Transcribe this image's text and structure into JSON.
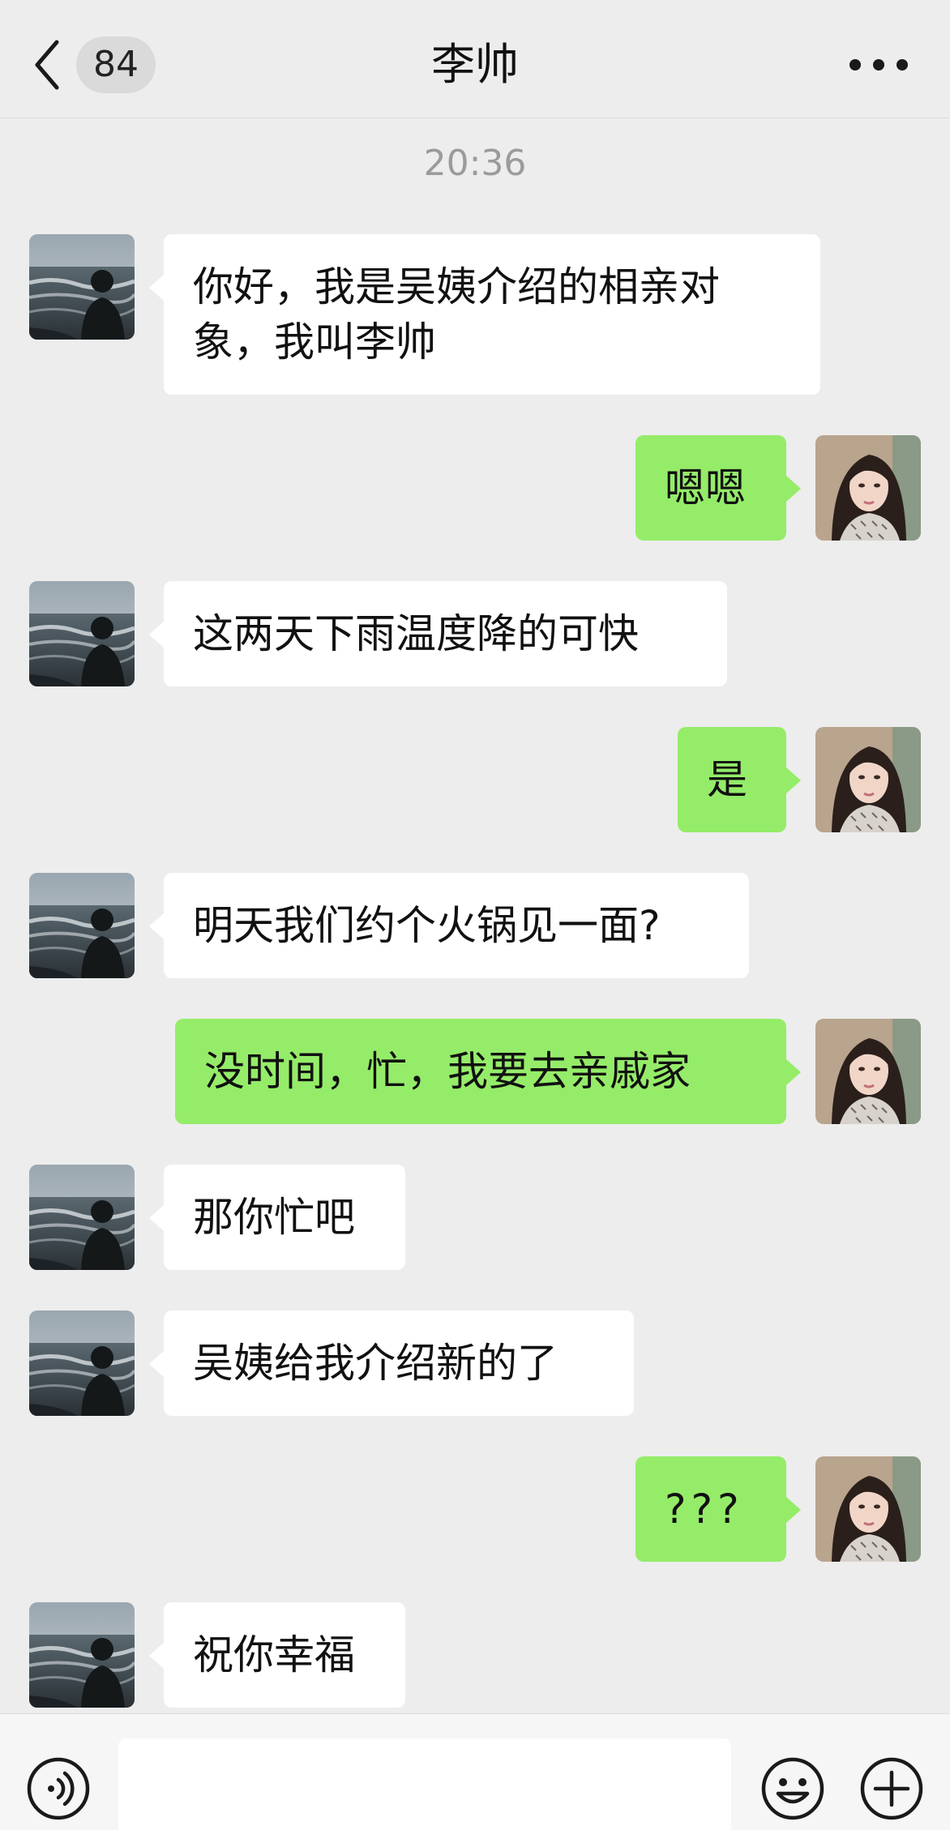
{
  "header": {
    "unread_count": "84",
    "title": "李帅"
  },
  "chat": {
    "timestamp": "20:36",
    "messages": [
      {
        "side": "in",
        "text": "你好，我是吴姨介绍的相亲对象，我叫李帅"
      },
      {
        "side": "out",
        "text": "嗯嗯"
      },
      {
        "side": "in",
        "text": "这两天下雨温度降的可快"
      },
      {
        "side": "out",
        "text": "是"
      },
      {
        "side": "in",
        "text": "明天我们约个火锅见一面?"
      },
      {
        "side": "out",
        "text": "没时间，忙，我要去亲戚家"
      },
      {
        "side": "in",
        "text": "那你忙吧"
      },
      {
        "side": "in",
        "text": "吴姨给我介绍新的了"
      },
      {
        "side": "out",
        "text": "???"
      },
      {
        "side": "in",
        "text": "祝你幸福"
      }
    ]
  },
  "input_bar": {
    "voice_icon": "voice-icon",
    "emoji_icon": "emoji-icon",
    "plus_icon": "plus-icon",
    "input_value": ""
  },
  "colors": {
    "background": "#ededed",
    "incoming_bubble": "#ffffff",
    "outgoing_bubble": "#95ec69"
  }
}
